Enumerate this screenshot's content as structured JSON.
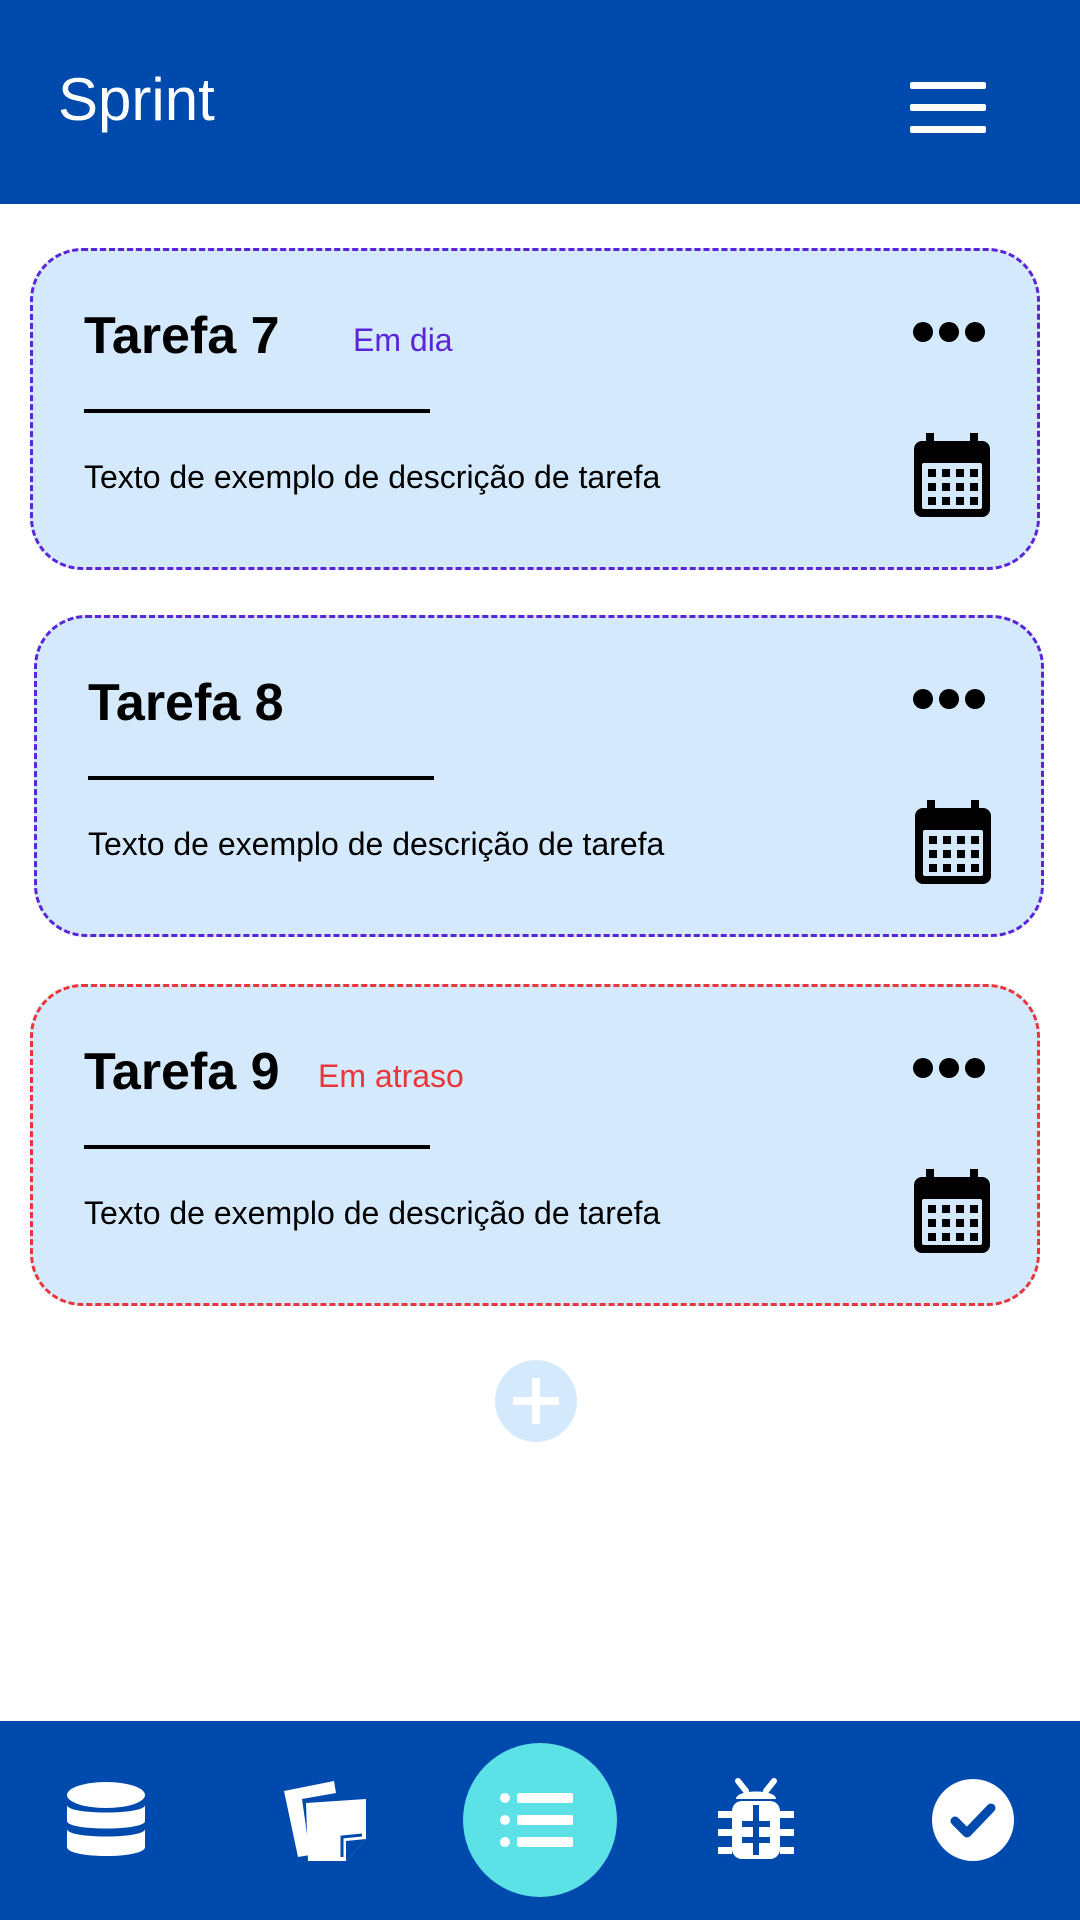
{
  "header": {
    "title": "Sprint",
    "menu_icon": "hamburger-menu-icon"
  },
  "tasks": [
    {
      "title": "Tarefa 7",
      "status": "Em dia",
      "status_color": "#5b24d9",
      "description": "Texto de exemplo de descrição de tarefa"
    },
    {
      "title": "Tarefa 8",
      "status": "",
      "status_color": "#5b24d9",
      "description": "Texto de exemplo de descrição de tarefa"
    },
    {
      "title": "Tarefa 9",
      "status": "Em atraso",
      "status_color": "#e8363c",
      "description": "Texto de exemplo de descrição de tarefa"
    }
  ],
  "add_task": {
    "icon": "plus-icon"
  },
  "bottom_nav": {
    "items": [
      {
        "icon": "database-icon",
        "active": false
      },
      {
        "icon": "cards-icon",
        "active": false
      },
      {
        "icon": "list-icon",
        "active": true
      },
      {
        "icon": "bug-icon",
        "active": false
      },
      {
        "icon": "check-circle-icon",
        "active": false
      }
    ]
  },
  "colors": {
    "primary": "#004aad",
    "card_background": "#d4eafc",
    "accent_active": "#5ce1e6",
    "on_time": "#5b24d9",
    "late": "#e8363c"
  }
}
